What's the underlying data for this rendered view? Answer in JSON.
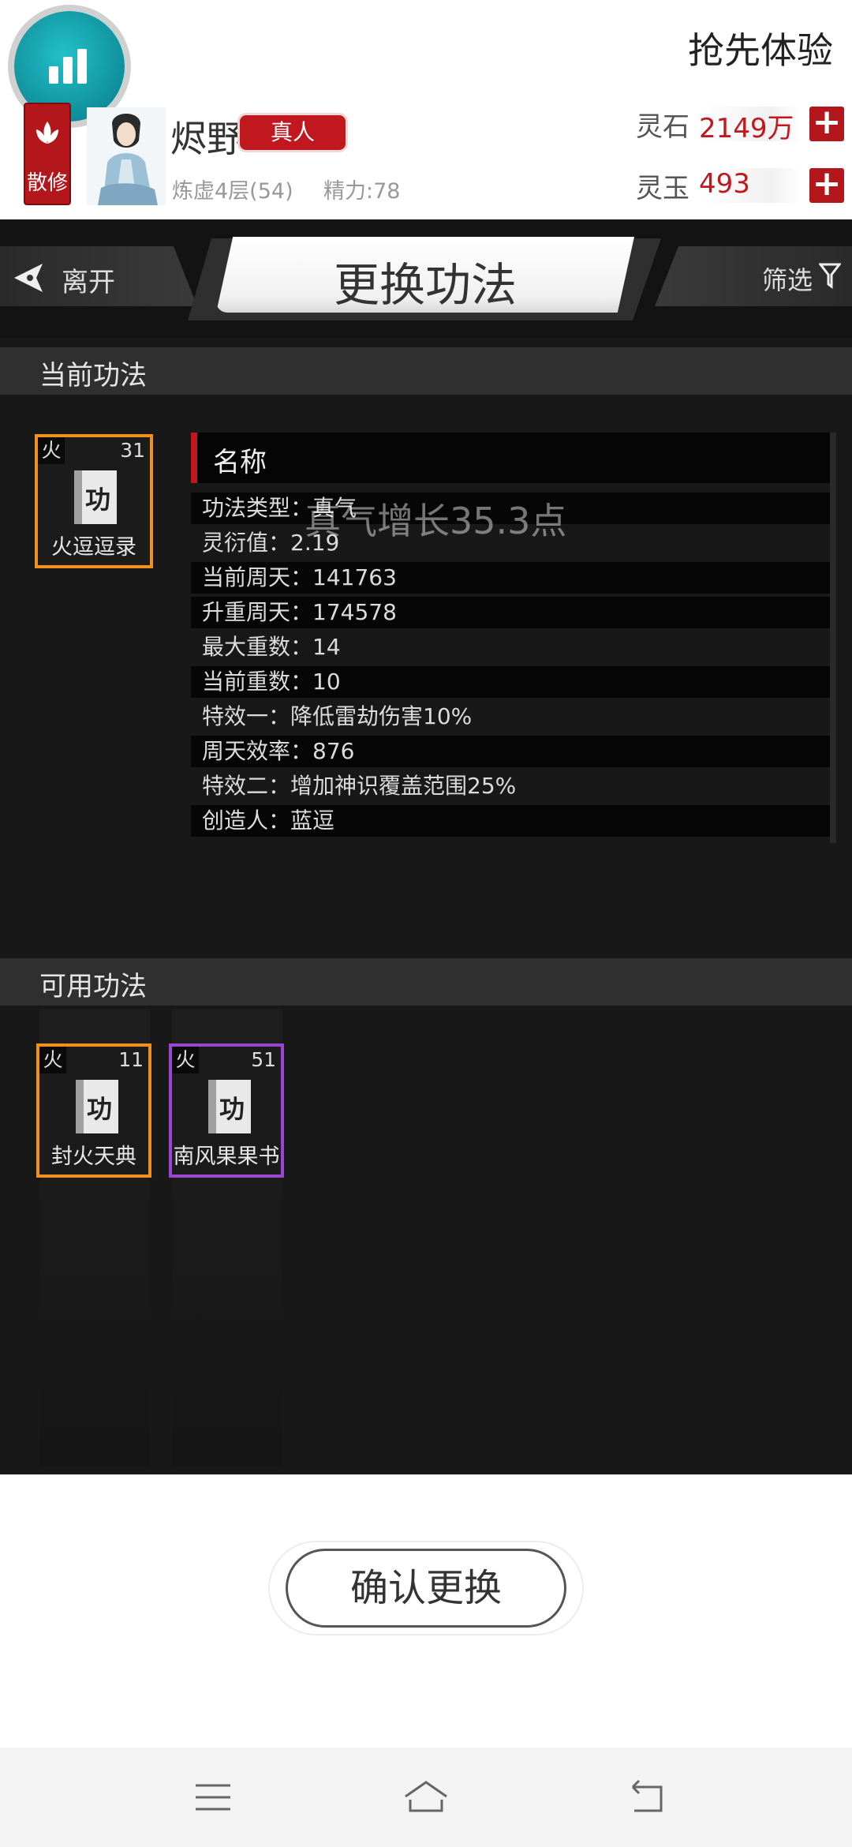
{
  "header": {
    "trial_link": "抢先体验",
    "sect": "散修",
    "player_name": "烬野",
    "badge": "真人",
    "cultivation": "炼虚4层(54)",
    "energy": "精力:78",
    "resources": [
      {
        "label": "灵石",
        "value": "2149万"
      },
      {
        "label": "灵玉",
        "value": "493"
      }
    ]
  },
  "titlebar": {
    "back_label": "离开",
    "title": "更换功法",
    "filter_label": "筛选"
  },
  "current": {
    "section_title": "当前功法",
    "card": {
      "element": "火",
      "level": "31",
      "glyph": "功",
      "name": "火逗逗录"
    },
    "detail": {
      "name_label": "名称",
      "overlay": "真气增长35.3点",
      "attributes": [
        "功法类型：真气",
        "灵衍值：2.19",
        "当前周天：141763",
        "升重周天：174578",
        "最大重数：14",
        "当前重数：10",
        "特效一：降低雷劫伤害10%",
        "周天效率：876",
        "特效二：增加神识覆盖范围25%",
        "创造人：蓝逗"
      ]
    }
  },
  "available": {
    "section_title": "可用功法",
    "cards": [
      {
        "element": "火",
        "level": "11",
        "glyph": "功",
        "name": "封火天典"
      },
      {
        "element": "火",
        "level": "51",
        "glyph": "功",
        "name": "南风果果书"
      }
    ]
  },
  "confirm_label": "确认更换",
  "colors": {
    "accent_red": "#c0181e",
    "orange_border": "#f0901e",
    "purple_border": "#9b46d0",
    "teal_fab": "#12a3ad"
  }
}
